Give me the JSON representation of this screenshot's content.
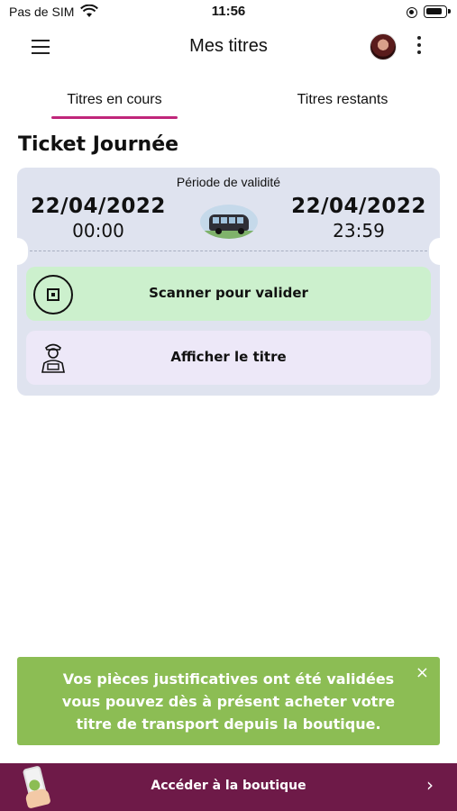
{
  "status_bar": {
    "carrier": "Pas de SIM",
    "time": "11:56",
    "icons": [
      "wifi-icon",
      "orientation-lock-icon",
      "battery-icon"
    ]
  },
  "header": {
    "title": "Mes titres",
    "menu_icon": "hamburger-menu-icon",
    "more_icon": "kebab-menu-icon"
  },
  "tabs": [
    {
      "label": "Titres en cours",
      "active": true
    },
    {
      "label": "Titres restants",
      "active": false
    }
  ],
  "ticket": {
    "title": "Ticket Journée",
    "validity_label": "Période de validité",
    "start_date": "22/04/2022",
    "start_time": "00:00",
    "end_date": "22/04/2022",
    "end_time": "23:59",
    "scan_label": "Scanner pour valider",
    "show_label": "Afficher le titre"
  },
  "notice": {
    "line1": "Vos pièces justificatives ont été validées",
    "line2": "vous pouvez dès à présent acheter votre",
    "line3": "titre de transport depuis la boutique.",
    "close": "×"
  },
  "bottom_bar": {
    "label": "Accéder à la boutique",
    "chevron": "›"
  },
  "colors": {
    "accent": "#c0267a",
    "card_bg": "#dfe3ef",
    "scan_bg": "#ccf0cd",
    "show_bg": "#ede8f8",
    "notice_bg": "#8cbd54",
    "bottom_bg": "#6e1a48"
  }
}
